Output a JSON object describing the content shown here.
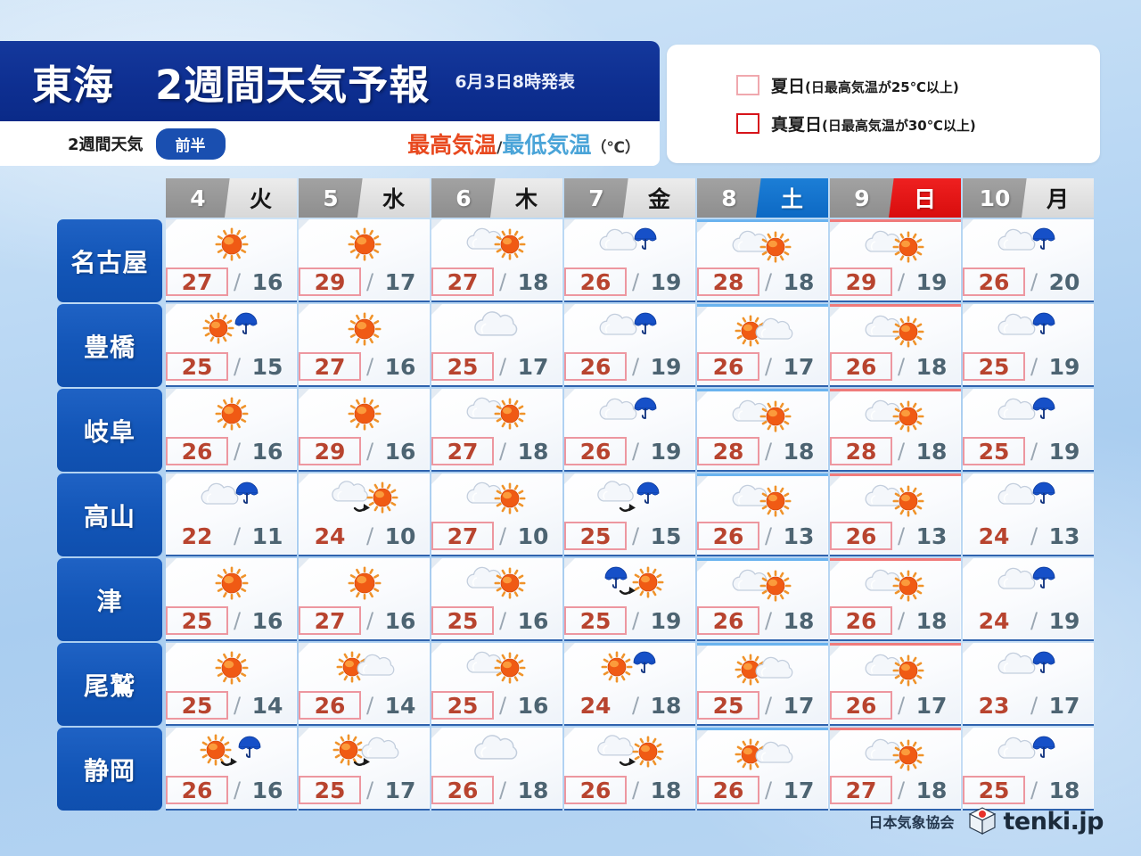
{
  "header": {
    "title": "東海　2週間天気予報",
    "issued": "6月3日8時発表",
    "sub_label": "2週間天気",
    "period_pill": "前半",
    "temp_key_high": "最高気温",
    "temp_key_sep": "/",
    "temp_key_low": "最低気温",
    "temp_key_unit": "（℃）"
  },
  "legend": {
    "items": [
      {
        "name": "夏日",
        "desc": "(日最高気温が25℃以上)",
        "color": "#f0a8ae"
      },
      {
        "name": "真夏日",
        "desc": "(日最高気温が30℃以上)",
        "color": "#d7141a"
      }
    ]
  },
  "columns": [
    {
      "date": "4",
      "dow": "火",
      "type": "weekday"
    },
    {
      "date": "5",
      "dow": "水",
      "type": "weekday"
    },
    {
      "date": "6",
      "dow": "木",
      "type": "weekday"
    },
    {
      "date": "7",
      "dow": "金",
      "type": "weekday"
    },
    {
      "date": "8",
      "dow": "土",
      "type": "saturday"
    },
    {
      "date": "9",
      "dow": "日",
      "type": "sunday"
    },
    {
      "date": "10",
      "dow": "月",
      "type": "weekday"
    }
  ],
  "rows": [
    {
      "city": "名古屋",
      "cells": [
        {
          "icon": "sunny",
          "high": "27",
          "low": "16",
          "slash": "/",
          "box": "summer"
        },
        {
          "icon": "sunny",
          "high": "29",
          "low": "17",
          "slash": "/",
          "box": "summer"
        },
        {
          "icon": "cloudy-sunny",
          "high": "27",
          "low": "18",
          "slash": "/",
          "box": "summer"
        },
        {
          "icon": "cloudy-rainy",
          "high": "26",
          "low": "19",
          "slash": "/",
          "box": "summer"
        },
        {
          "icon": "cloudy-sunny",
          "high": "28",
          "low": "18",
          "slash": "/",
          "box": "summer"
        },
        {
          "icon": "cloudy-sunny",
          "high": "29",
          "low": "19",
          "slash": "/",
          "box": "summer"
        },
        {
          "icon": "cloudy-rainy",
          "high": "26",
          "low": "20",
          "slash": "/",
          "box": "summer"
        }
      ]
    },
    {
      "city": "豊橋",
      "cells": [
        {
          "icon": "sunny-rainy",
          "high": "25",
          "low": "15",
          "slash": "/",
          "box": "summer"
        },
        {
          "icon": "sunny",
          "high": "27",
          "low": "16",
          "slash": "/",
          "box": "summer"
        },
        {
          "icon": "cloudy",
          "high": "25",
          "low": "17",
          "slash": "/",
          "box": "summer"
        },
        {
          "icon": "cloudy-rainy",
          "high": "26",
          "low": "19",
          "slash": "/",
          "box": "summer"
        },
        {
          "icon": "sunny-cloudy",
          "high": "26",
          "low": "17",
          "slash": "/",
          "box": "summer"
        },
        {
          "icon": "cloudy-sunny",
          "high": "26",
          "low": "18",
          "slash": "/",
          "box": "summer"
        },
        {
          "icon": "cloudy-rainy",
          "high": "25",
          "low": "19",
          "slash": "/",
          "box": "summer"
        }
      ]
    },
    {
      "city": "岐阜",
      "cells": [
        {
          "icon": "sunny",
          "high": "26",
          "low": "16",
          "slash": "/",
          "box": "summer"
        },
        {
          "icon": "sunny",
          "high": "29",
          "low": "16",
          "slash": "/",
          "box": "summer"
        },
        {
          "icon": "cloudy-sunny",
          "high": "27",
          "low": "18",
          "slash": "/",
          "box": "summer"
        },
        {
          "icon": "cloudy-rainy",
          "high": "26",
          "low": "19",
          "slash": "/",
          "box": "summer"
        },
        {
          "icon": "cloudy-sunny",
          "high": "28",
          "low": "18",
          "slash": "/",
          "box": "summer"
        },
        {
          "icon": "cloudy-sunny",
          "high": "28",
          "low": "18",
          "slash": "/",
          "box": "summer"
        },
        {
          "icon": "cloudy-rainy",
          "high": "25",
          "low": "19",
          "slash": "/",
          "box": "summer"
        }
      ]
    },
    {
      "city": "高山",
      "cells": [
        {
          "icon": "cloudy-rainy",
          "high": "22",
          "low": "11",
          "slash": "/",
          "box": "none"
        },
        {
          "icon": "cloudy-later-sunny",
          "high": "24",
          "low": "10",
          "slash": "/",
          "box": "none"
        },
        {
          "icon": "cloudy-sunny",
          "high": "27",
          "low": "10",
          "slash": "/",
          "box": "summer"
        },
        {
          "icon": "cloudy-later-rainy",
          "high": "25",
          "low": "15",
          "slash": "/",
          "box": "summer"
        },
        {
          "icon": "cloudy-sunny",
          "high": "26",
          "low": "13",
          "slash": "/",
          "box": "summer"
        },
        {
          "icon": "cloudy-sunny",
          "high": "26",
          "low": "13",
          "slash": "/",
          "box": "summer"
        },
        {
          "icon": "cloudy-rainy",
          "high": "24",
          "low": "13",
          "slash": "/",
          "box": "none"
        }
      ]
    },
    {
      "city": "津",
      "cells": [
        {
          "icon": "sunny",
          "high": "25",
          "low": "16",
          "slash": "/",
          "box": "summer"
        },
        {
          "icon": "sunny",
          "high": "27",
          "low": "16",
          "slash": "/",
          "box": "summer"
        },
        {
          "icon": "cloudy-sunny",
          "high": "25",
          "low": "16",
          "slash": "/",
          "box": "summer"
        },
        {
          "icon": "rainy-later-sunny",
          "high": "25",
          "low": "19",
          "slash": "/",
          "box": "summer"
        },
        {
          "icon": "cloudy-sunny",
          "high": "26",
          "low": "18",
          "slash": "/",
          "box": "summer"
        },
        {
          "icon": "cloudy-sunny",
          "high": "26",
          "low": "18",
          "slash": "/",
          "box": "summer"
        },
        {
          "icon": "cloudy-rainy",
          "high": "24",
          "low": "19",
          "slash": "/",
          "box": "none"
        }
      ]
    },
    {
      "city": "尾鷲",
      "cells": [
        {
          "icon": "sunny",
          "high": "25",
          "low": "14",
          "slash": "/",
          "box": "summer"
        },
        {
          "icon": "sunny-cloudy",
          "high": "26",
          "low": "14",
          "slash": "/",
          "box": "summer"
        },
        {
          "icon": "cloudy-sunny",
          "high": "25",
          "low": "16",
          "slash": "/",
          "box": "summer"
        },
        {
          "icon": "sunny-rainy",
          "high": "24",
          "low": "18",
          "slash": "/",
          "box": "none"
        },
        {
          "icon": "sunny-cloudy",
          "high": "25",
          "low": "17",
          "slash": "/",
          "box": "summer"
        },
        {
          "icon": "cloudy-sunny",
          "high": "26",
          "low": "17",
          "slash": "/",
          "box": "summer"
        },
        {
          "icon": "cloudy-rainy",
          "high": "23",
          "low": "17",
          "slash": "/",
          "box": "none"
        }
      ]
    },
    {
      "city": "静岡",
      "cells": [
        {
          "icon": "sunny-later-rainy",
          "high": "26",
          "low": "16",
          "slash": "/",
          "box": "summer"
        },
        {
          "icon": "sunny-later-cloudy",
          "high": "25",
          "low": "17",
          "slash": "/",
          "box": "summer"
        },
        {
          "icon": "cloudy",
          "high": "26",
          "low": "18",
          "slash": "/",
          "box": "summer"
        },
        {
          "icon": "cloudy-later-sunny",
          "high": "26",
          "low": "18",
          "slash": "/",
          "box": "summer"
        },
        {
          "icon": "sunny-cloudy",
          "high": "26",
          "low": "17",
          "slash": "/",
          "box": "summer"
        },
        {
          "icon": "cloudy-sunny",
          "high": "27",
          "low": "18",
          "slash": "/",
          "box": "summer"
        },
        {
          "icon": "cloudy-rainy",
          "high": "25",
          "low": "18",
          "slash": "/",
          "box": "summer"
        }
      ]
    }
  ],
  "footer": {
    "association": "日本気象協会",
    "brand": "tenki.jp"
  }
}
